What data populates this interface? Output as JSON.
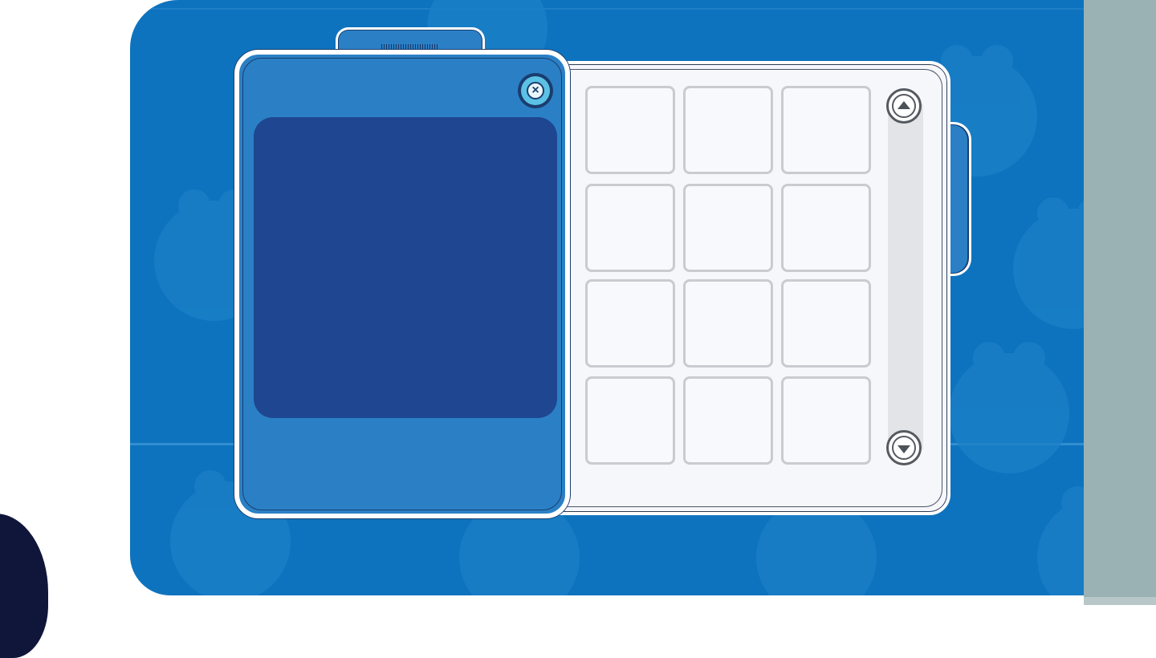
{
  "screen": {
    "background_color": "#0e73be",
    "side_panel_color": "#9ab2b3"
  },
  "player_card": {
    "close_icon": "close-x-icon",
    "card_color": "#2b80c5",
    "preview_color": "#1f4690"
  },
  "inventory": {
    "rows": 4,
    "columns": 3,
    "slots": [
      {
        "item": ""
      },
      {
        "item": ""
      },
      {
        "item": ""
      },
      {
        "item": ""
      },
      {
        "item": ""
      },
      {
        "item": ""
      },
      {
        "item": ""
      },
      {
        "item": ""
      },
      {
        "item": ""
      },
      {
        "item": ""
      },
      {
        "item": ""
      },
      {
        "item": ""
      }
    ]
  },
  "scrollbar": {
    "up_icon": "scroll-up-icon",
    "down_icon": "scroll-down-icon"
  }
}
